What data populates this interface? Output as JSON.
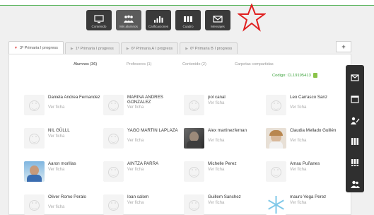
{
  "toolbar": {
    "buttons": [
      {
        "label": "Contenido",
        "icon": "monitor-icon"
      },
      {
        "label": "Mis alumnos",
        "icon": "students-icon"
      },
      {
        "label": "Calificaciones",
        "icon": "bar-chart-icon"
      },
      {
        "label": "Cuadro",
        "icon": "grid-icon"
      },
      {
        "label": "Mensajes",
        "icon": "envelope-icon"
      }
    ]
  },
  "tabs": [
    {
      "label": "3º Primaria I progress"
    },
    {
      "label": "1º Primaria I progress"
    },
    {
      "label": "6º Primaria A I progress"
    },
    {
      "label": "6º Primaria B I progress"
    }
  ],
  "tab_add": "+",
  "subtabs": {
    "alumnos": "Alumnos (36)",
    "profesores": "Profesores (1)",
    "contenido": "Contenido (2)",
    "carpetas": "Carpetas compartidas"
  },
  "code_label": "Codigo: CL19195413",
  "ver_ficha": "Ver ficha",
  "students": [
    {
      "name": "Daniela Andrea Fernandez"
    },
    {
      "name": "MARINA ANDRES GONZALEZ"
    },
    {
      "name": "pol canal"
    },
    {
      "name": "Leo Carrasco Sanz"
    },
    {
      "name": "NIL GÜLLL"
    },
    {
      "name": "YAGO MARTIN LAPLAZA"
    },
    {
      "name": "Alex martinezfernan"
    },
    {
      "name": "Claudia Mellado Guillén"
    },
    {
      "name": "Aaron morillas"
    },
    {
      "name": "AINTZA PARRA"
    },
    {
      "name": "Michelle Perez"
    },
    {
      "name": "Amau Puñanes"
    },
    {
      "name": "Oliver Romo Peralo"
    },
    {
      "name": "Ioan salom"
    },
    {
      "name": "Guillem Sanchez"
    },
    {
      "name": "mauro Vega Perez"
    }
  ],
  "colors": {
    "toolbar_bg": "#3a3a3a",
    "accent_green": "#3da33d",
    "tab_arrow_red": "#e04040",
    "sidebar_bg": "#2f2f2f",
    "annotation_star": "#e02020"
  }
}
